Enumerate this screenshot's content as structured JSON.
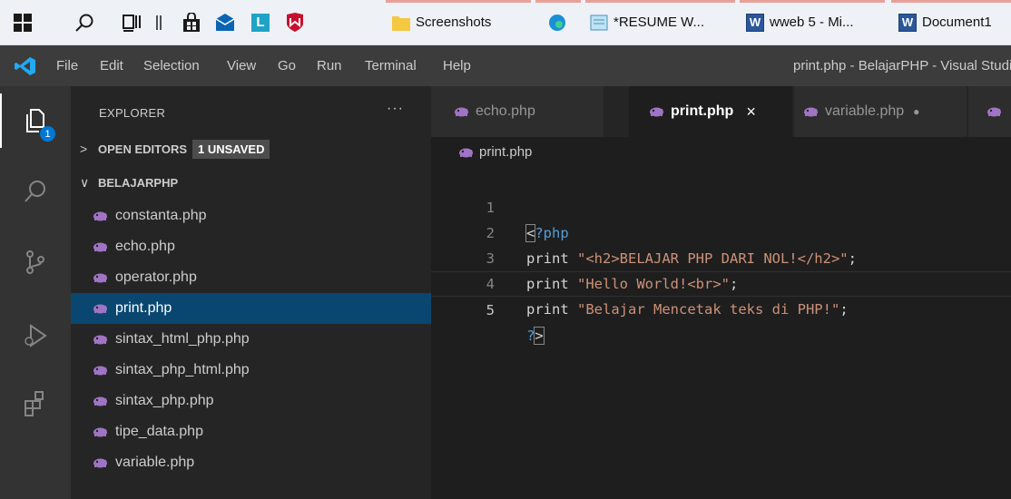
{
  "taskbar": {
    "apps": [
      {
        "label": "Screenshots",
        "icon": "folder-icon"
      },
      {
        "label": "",
        "icon": "edge-icon"
      },
      {
        "label": "*RESUME W...",
        "icon": "notepad-icon"
      },
      {
        "label": "wweb 5 - Mi...",
        "icon": "word-icon"
      },
      {
        "label": "Document1",
        "icon": "word-icon"
      }
    ]
  },
  "titlebar": {
    "menu": [
      "File",
      "Edit",
      "Selection",
      "View",
      "Go",
      "Run",
      "Terminal",
      "Help"
    ],
    "title": "print.php - BelajarPHP - Visual Studio Code"
  },
  "activity": {
    "explorer_badge": "1"
  },
  "sidebar": {
    "title": "EXPLORER",
    "more": "···",
    "open_editors": {
      "label": "OPEN EDITORS",
      "badge": "1 UNSAVED"
    },
    "folder": {
      "label": "BELAJARPHP"
    },
    "files": [
      "constanta.php",
      "echo.php",
      "operator.php",
      "print.php",
      "sintax_html_php.php",
      "sintax_php_html.php",
      "sintax_php.php",
      "tipe_data.php",
      "variable.php"
    ],
    "selected_index": 3
  },
  "tabs": [
    {
      "label": "echo.php",
      "state": ""
    },
    {
      "label": "print.php",
      "state": "×"
    },
    {
      "label": "variable.php",
      "state": "●"
    }
  ],
  "breadcrumb": "print.php",
  "editor": {
    "line_numbers": [
      "1",
      "2",
      "3",
      "4",
      "5"
    ],
    "lines": [
      {
        "open": "<",
        "tag": "?php"
      },
      {
        "kw": "print",
        "str": "\"<h2>BELAJAR PHP DARI NOL!</h2>\"",
        "end": ";"
      },
      {
        "kw": "print",
        "str": "\"Hello World!<br>\"",
        "end": ";"
      },
      {
        "kw": "print",
        "str": "\"Belajar Mencetak teks di PHP!\"",
        "end": ";"
      },
      {
        "tag": "?",
        "close": ">"
      }
    ]
  },
  "colors": {
    "accent": "#094771",
    "php_icon": "#a074c4",
    "badge": "#0078d4"
  }
}
